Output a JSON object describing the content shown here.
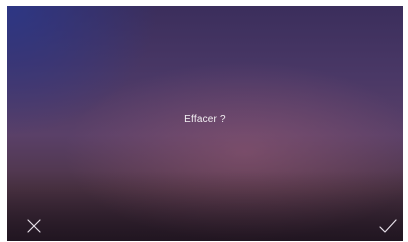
{
  "dialog": {
    "prompt": "Effacer ?"
  },
  "actions": {
    "cancel_icon": "close-icon",
    "confirm_icon": "check-icon"
  },
  "colors": {
    "icon": "#e6dfe8",
    "text": "#ffffff"
  }
}
